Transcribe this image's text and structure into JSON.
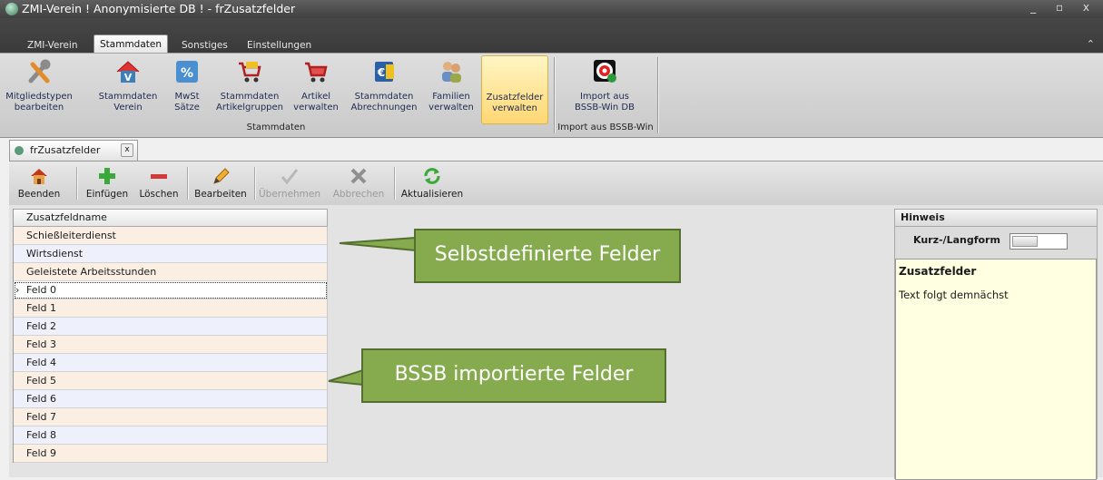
{
  "window": {
    "title": "ZMI-Verein  ! Anonymisierte DB !  - frZusatzfelder",
    "controls": "_ ▫ x"
  },
  "ribbon_tabs": [
    {
      "label": "ZMI-Verein",
      "active": false
    },
    {
      "label": "Stammdaten",
      "active": true
    },
    {
      "label": "Sonstiges",
      "active": false
    },
    {
      "label": "Einstellungen",
      "active": false
    }
  ],
  "ribbon": {
    "buttons": [
      {
        "line1": "Mitgliedstypen",
        "line2": "bearbeiten",
        "icon": "tools-icon"
      },
      {
        "line1": "Stammdaten",
        "line2": "Verein",
        "icon": "house-v-icon"
      },
      {
        "line1": "MwSt",
        "line2": "Sätze",
        "icon": "percent-icon"
      },
      {
        "line1": "Stammdaten",
        "line2": "Artikelgruppen",
        "icon": "cart-yellow-icon"
      },
      {
        "line1": "Artikel",
        "line2": "verwalten",
        "icon": "cart-red-icon"
      },
      {
        "line1": "Stammdaten",
        "line2": "Abrechnungen",
        "icon": "euro-icon"
      },
      {
        "line1": "Familien",
        "line2": "verwalten",
        "icon": "people-icon"
      },
      {
        "line1": "Zusatzfelder",
        "line2": "verwalten",
        "icon": "",
        "selected": true
      },
      {
        "line1": "Import aus",
        "line2": "BSSB-Win DB",
        "icon": "target-icon"
      }
    ],
    "group_stammdaten": "Stammdaten",
    "group_import": "Import aus BSSB-Win"
  },
  "doc_tab": {
    "label": "frZusatzfelder",
    "close": "x"
  },
  "toolbar": {
    "buttons": [
      {
        "label": "Beenden",
        "enabled": true,
        "icon": "home-icon"
      },
      {
        "label": "Einfügen",
        "enabled": true,
        "icon": "plus-icon"
      },
      {
        "label": "Löschen",
        "enabled": true,
        "icon": "minus-icon"
      },
      {
        "label": "Bearbeiten",
        "enabled": true,
        "icon": "pencil-icon"
      },
      {
        "label": "Übernehmen",
        "enabled": false,
        "icon": "check-icon"
      },
      {
        "label": "Abbrechen",
        "enabled": false,
        "icon": "cancel-icon"
      },
      {
        "label": "Aktualisieren",
        "enabled": true,
        "icon": "refresh-icon"
      }
    ]
  },
  "grid": {
    "header": "Zusatzfeldname",
    "current_row_indicator": "›",
    "rows": [
      "Schießleiterdienst",
      "Wirtsdienst",
      "Geleistete Arbeitsstunden",
      "Feld 0",
      "Feld 1",
      "Feld 2",
      "Feld 3",
      "Feld 4",
      "Feld 5",
      "Feld 6",
      "Feld 7",
      "Feld 8",
      "Feld 9"
    ]
  },
  "callouts": {
    "top": "Selbstdefinierte Felder",
    "bottom": "BSSB importierte Felder"
  },
  "hinweis": {
    "header": "Hinweis",
    "toggle_label": "Kurz-/Langform",
    "note_title": "Zusatzfelder",
    "note_text": "Text folgt demnächst"
  },
  "colors": {
    "callout_fill": "#86ab4e",
    "callout_border": "#556f30",
    "selected_ribbon": "#ffd774",
    "note_bg": "#ffffe1"
  }
}
